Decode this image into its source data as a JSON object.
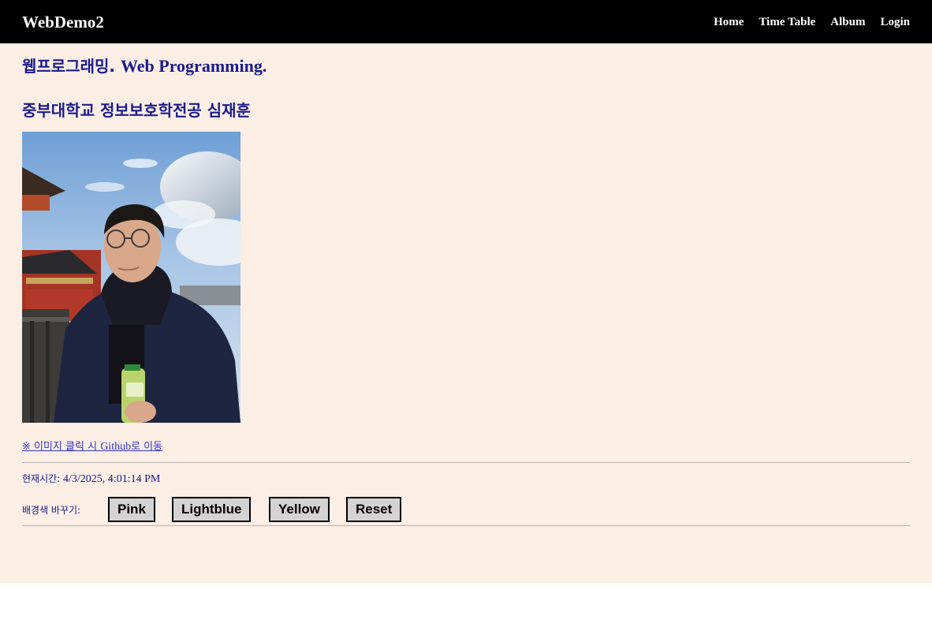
{
  "navbar": {
    "brand": "WebDemo2",
    "links": [
      "Home",
      "Time Table",
      "Album",
      "Login"
    ]
  },
  "headings": {
    "title_korean": "웹프로그래밍.",
    "title_latin": "Web Programming.",
    "subtitle": "중부대학교 정보보호학전공 심재훈"
  },
  "photo": {
    "alt": "profile photo"
  },
  "github_link": {
    "prefix": "※ 이미지 클릭 시 ",
    "latin": "Github",
    "suffix": "로 이동"
  },
  "clock": {
    "label": "현재시간: ",
    "value": "4/3/2025, 4:01:14 PM"
  },
  "bg_controls": {
    "label": "배경색 바꾸기:",
    "buttons": [
      "Pink",
      "Lightblue",
      "Yellow",
      "Reset"
    ]
  },
  "colors": {
    "page_bg": "#faeee5",
    "navbar_bg": "#000000",
    "heading": "#1a1a8c",
    "link": "#3333cc",
    "button_bg": "#d4d2d2"
  }
}
